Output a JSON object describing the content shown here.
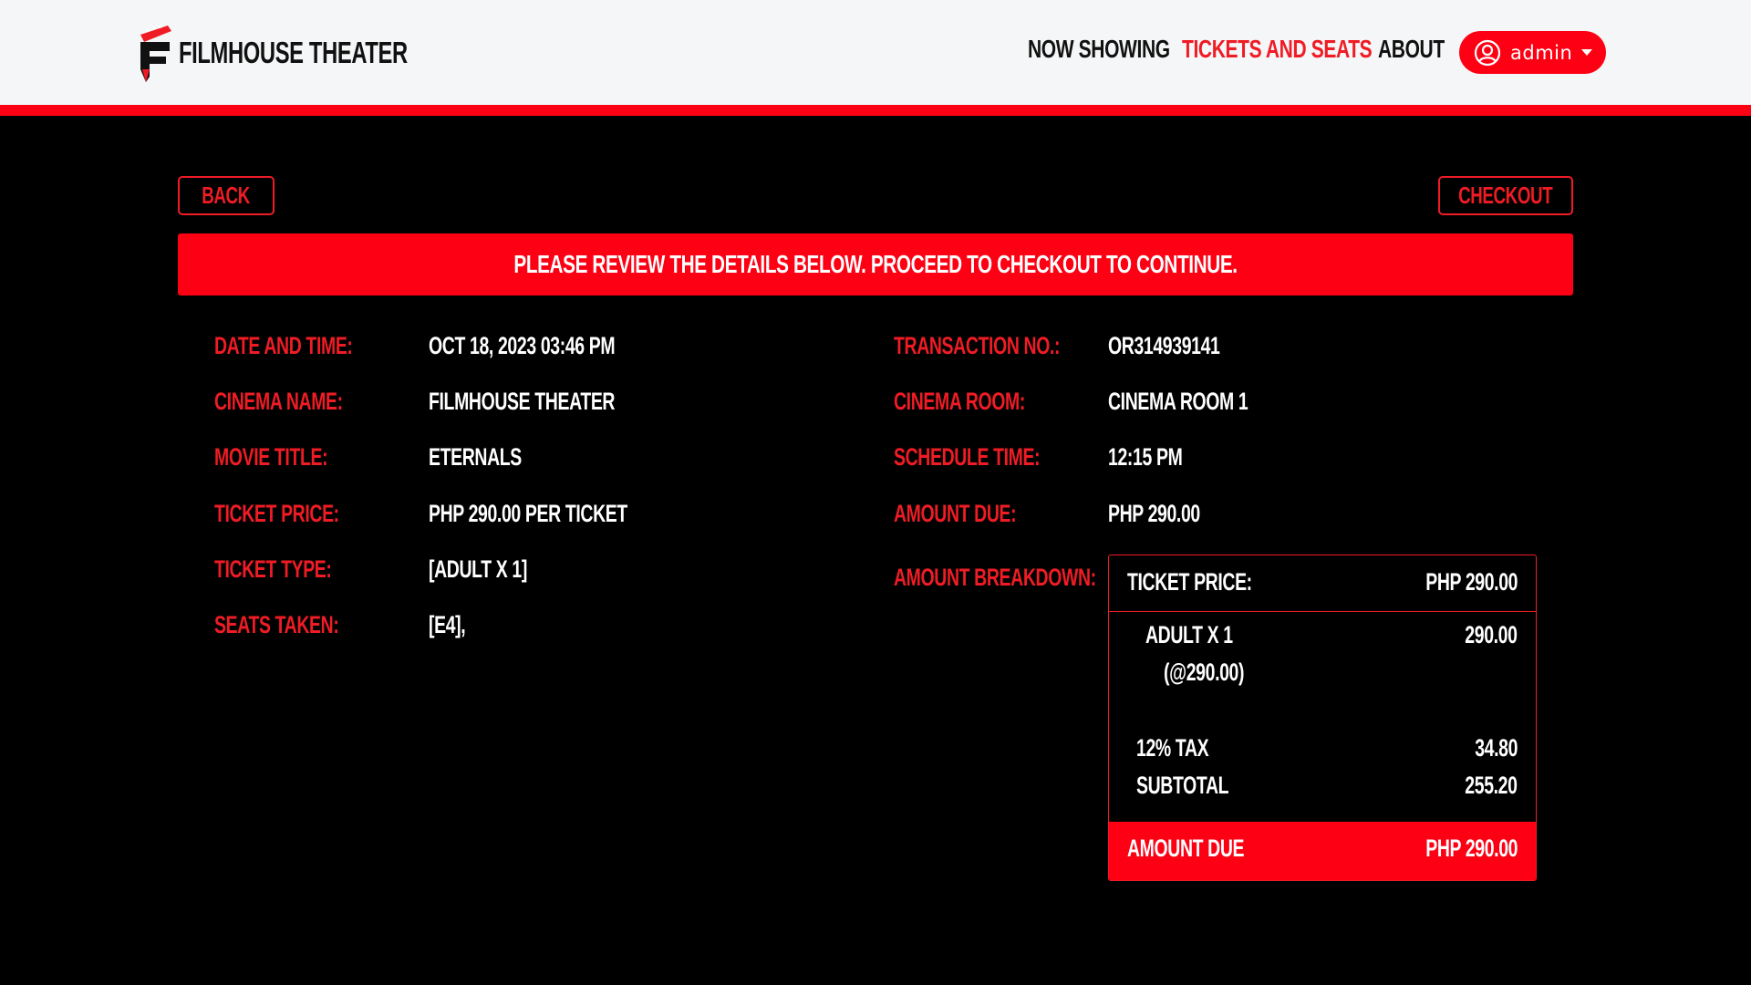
{
  "header": {
    "brand": "FILMHOUSE THEATER",
    "nav": {
      "now_showing": "NOW SHOWING",
      "tickets_and_seats": "TICKETS AND SEATS",
      "about": "ABOUT"
    },
    "user": "admin",
    "accent": "#fe0013"
  },
  "actions": {
    "back": "BACK",
    "checkout": "CHECKOUT"
  },
  "banner": "PLEASE REVIEW THE DETAILS BELOW. PROCEED TO CHECKOUT TO CONTINUE.",
  "details_left": [
    {
      "label": "DATE AND TIME:",
      "value": "OCT 18, 2023 03:46 PM"
    },
    {
      "label": "CINEMA NAME:",
      "value": "FILMHOUSE THEATER"
    },
    {
      "label": "MOVIE TITLE:",
      "value": "ETERNALS"
    },
    {
      "label": "TICKET PRICE:",
      "value": "PHP 290.00 PER TICKET"
    },
    {
      "label": "TICKET TYPE:",
      "value": "[ADULT X 1]"
    },
    {
      "label": "SEATS TAKEN:",
      "value": "[E4],"
    }
  ],
  "details_right": [
    {
      "label": "TRANSACTION NO.:",
      "value": "OR314939141"
    },
    {
      "label": "CINEMA ROOM:",
      "value": "CINEMA ROOM 1"
    },
    {
      "label": "SCHEDULE TIME:",
      "value": "12:15 PM"
    },
    {
      "label": "AMOUNT DUE:",
      "value": "PHP 290.00"
    },
    {
      "label": "AMOUNT BREAKDOWN:",
      "value": ""
    }
  ],
  "breakdown": {
    "head_label": "TICKET PRICE:",
    "head_value": "PHP 290.00",
    "item_label": "ADULT X 1",
    "item_sub": "(@290.00)",
    "item_value": "290.00",
    "tax_label": "12% TAX",
    "tax_value": "34.80",
    "subtotal_label": "SUBTOTAL",
    "subtotal_value": "255.20",
    "due_label": "AMOUNT DUE",
    "due_value": "PHP 290.00"
  }
}
